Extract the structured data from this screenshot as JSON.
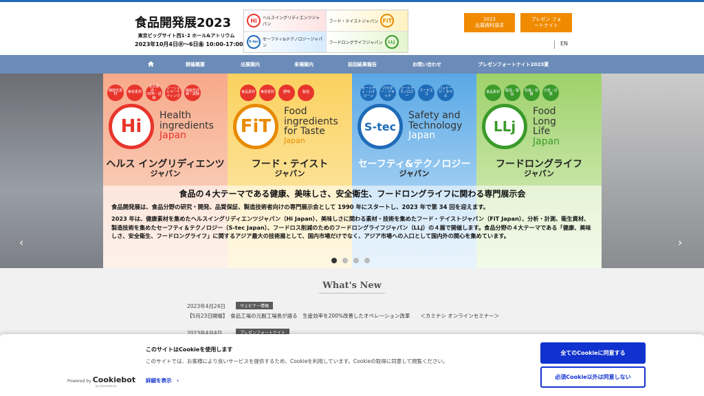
{
  "header": {
    "logo": {
      "title": "食品開発展2023",
      "venue": "東京ビッグサイト西1･2 ホール&アトリウム",
      "dates": "2023年10月4日㊌～6日㊎ 10:00-17:00"
    },
    "banner": [
      {
        "icon": "Hi",
        "text": "ヘルスイングリディエンツジャパン"
      },
      {
        "icon": "FiT",
        "text": "フード・テイストジャパン"
      },
      {
        "icon": "S-tec",
        "text": "セーフティ&テクノロジージャパン"
      },
      {
        "icon": "LLj",
        "text": "フードロングライフジャパン"
      }
    ],
    "btn_brochure": "2023\n出展資料請求",
    "btn_presentation": "プレゼン フォ\nートナイト",
    "lang": "EN"
  },
  "nav": {
    "home_icon": "home-icon",
    "items": [
      "開催概要",
      "出展案内",
      "来場案内",
      "前回結果報告",
      "お問い合わせ",
      "プレゼンフォートナイト2023夏"
    ]
  },
  "hero": {
    "pillars": [
      {
        "abbr": "Hi",
        "en1": "Health",
        "en2": "ingredients",
        "en3": "Japan",
        "jp": "ヘルス イングリディエンツ",
        "jp2": "ジャパン",
        "color": "#e8352b",
        "tags": [
          "機能性素材",
          "美容素材",
          "受託製造・OEM・試験",
          "ソーシャルマーケティング",
          "機能性評価・試験"
        ]
      },
      {
        "abbr": "FiT",
        "en1": "Food",
        "en2": "ingredients",
        "en3": "for Taste",
        "en4": "Japan",
        "jp": "フード・テイスト",
        "jp2": "ジャパン",
        "color": "#e88a00",
        "tags": [
          "食品素材",
          "美容素材",
          "野味",
          "製造"
        ]
      },
      {
        "abbr": "S-tec",
        "en1": "Safety and",
        "en2": "Technology",
        "en3": "Japan",
        "jp": "セーフティ&テクノロジー",
        "jp2": "ジャパン",
        "color": "#1e6bb8",
        "tags": [
          "セーフティ・ハイジーン",
          "パウダー・リキッド",
          "フードテクノロジー",
          "フードエコ",
          "パッケージ・ラベル"
        ]
      },
      {
        "abbr": "LLj",
        "en1": "Food",
        "en2": "Long",
        "en3": "Life",
        "en4": "Japan",
        "jp": "フードロングライフ",
        "jp2": "ジャパン",
        "color": "#3a9a2a",
        "tags": [
          "食品素材",
          "製造・製品",
          "包装・容器",
          "分析・計測"
        ]
      }
    ],
    "headline": "食品の４大テーマである健康、美味しさ、安全衛生、フードロングライフに関わる専門展示会",
    "lead1": "食品開発展は、食品分野の研究・開発、品質保証、製造技術者向けの専門展示会として 1990 年にスタートし、2023 年で第 34 回を迎えます。",
    "lead2": "2023 年は、健康素材を集めたヘルスイングリディエンツジャパン（Hi Japan）、美味しさに関わる素材・技術を集めたフード・テイストジャパン（FiT Japan）、分析・計測、衛生資材、製造技術を集めたセーフティ＆テクノロジー（S-tec Japan）、フードロス削減のためのフードロングライフジャパン（LLj）の４展で開催します。食品分野の４大テーマである「健康、美味しさ、安全衛生、フードロングライフ」に関するアジア最大の技術展として、国内市場だけでなく、アジア市場への入口として国内外の関心を集めています。",
    "active_slide": 1,
    "slide_count": 4
  },
  "whats_new": {
    "title": "What's New",
    "items": [
      {
        "date": "2023年4月24日",
        "tag": "ウェビナー情報",
        "text": "【5月23日開催】　食品工場の元副工場長が語る　生産効率を200%改善したオペレーション改革　　＜カミナシ オンラインセミナー＞"
      },
      {
        "date": "2023年4月4日",
        "tag": "プレゼンフォートナイト",
        "text": ""
      }
    ]
  },
  "cookie": {
    "title": "このサイトはCookieを使用します",
    "body": "このサイトでは、お客様により良いサービスを提供するため、Cookieを利用しています。Cookieの取得に同意して閲覧ください。",
    "detail": "詳細を表示　›",
    "powered": "Powered by",
    "brand": "Cookiebot",
    "by": "by Usercentrics",
    "accept": "全てのCookieに同意する",
    "deny": "必須Cookie以外は同意しない"
  }
}
